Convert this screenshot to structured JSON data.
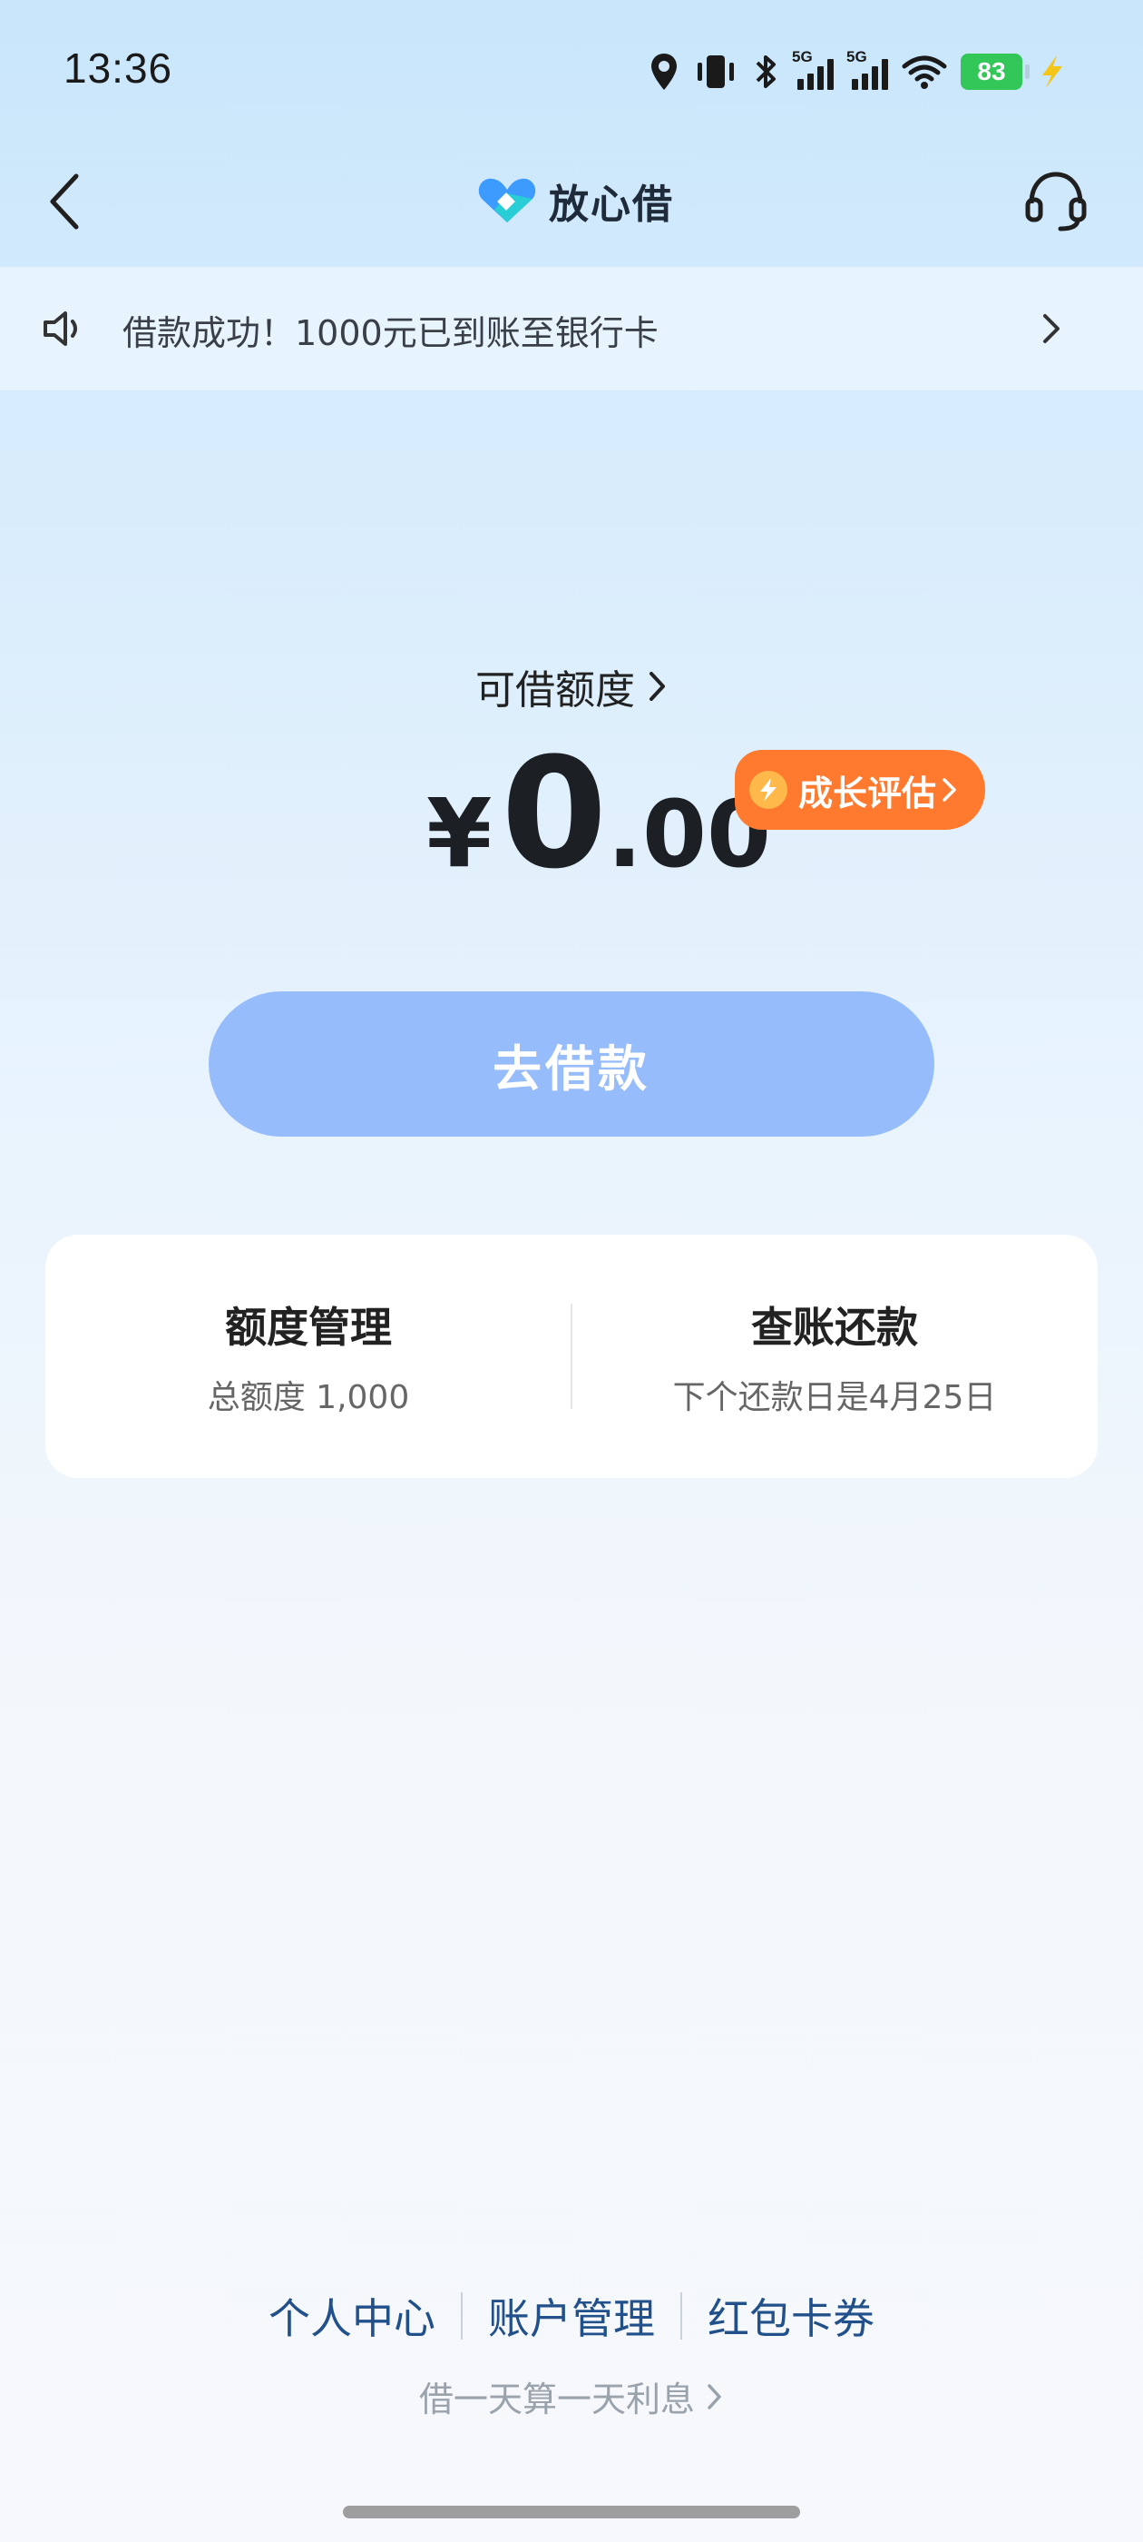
{
  "status_bar": {
    "time": "13:36",
    "network_tag_1": "5G",
    "network_tag_2": "5G",
    "battery": "83"
  },
  "header": {
    "brand_name": "放心借"
  },
  "notice": {
    "text": "借款成功！1000元已到账至银行卡"
  },
  "credit": {
    "label": "可借额度",
    "currency": "¥",
    "integer": "0",
    "decimal": ".00",
    "growth_label": "成长评估"
  },
  "borrow_button": {
    "label": "去借款"
  },
  "card": {
    "left": {
      "title": "额度管理",
      "subtitle": "总额度 1,000"
    },
    "right": {
      "title": "查账还款",
      "subtitle": "下个还款日是4月25日"
    }
  },
  "footer": {
    "links": [
      "个人中心",
      "账户管理",
      "红包卡券"
    ],
    "note": "借一天算一天利息"
  },
  "colors": {
    "accent_orange": "#ff7a2e",
    "borrow_button": "#96bcfb",
    "battery_green": "#33c759",
    "footer_link": "#21508a"
  }
}
